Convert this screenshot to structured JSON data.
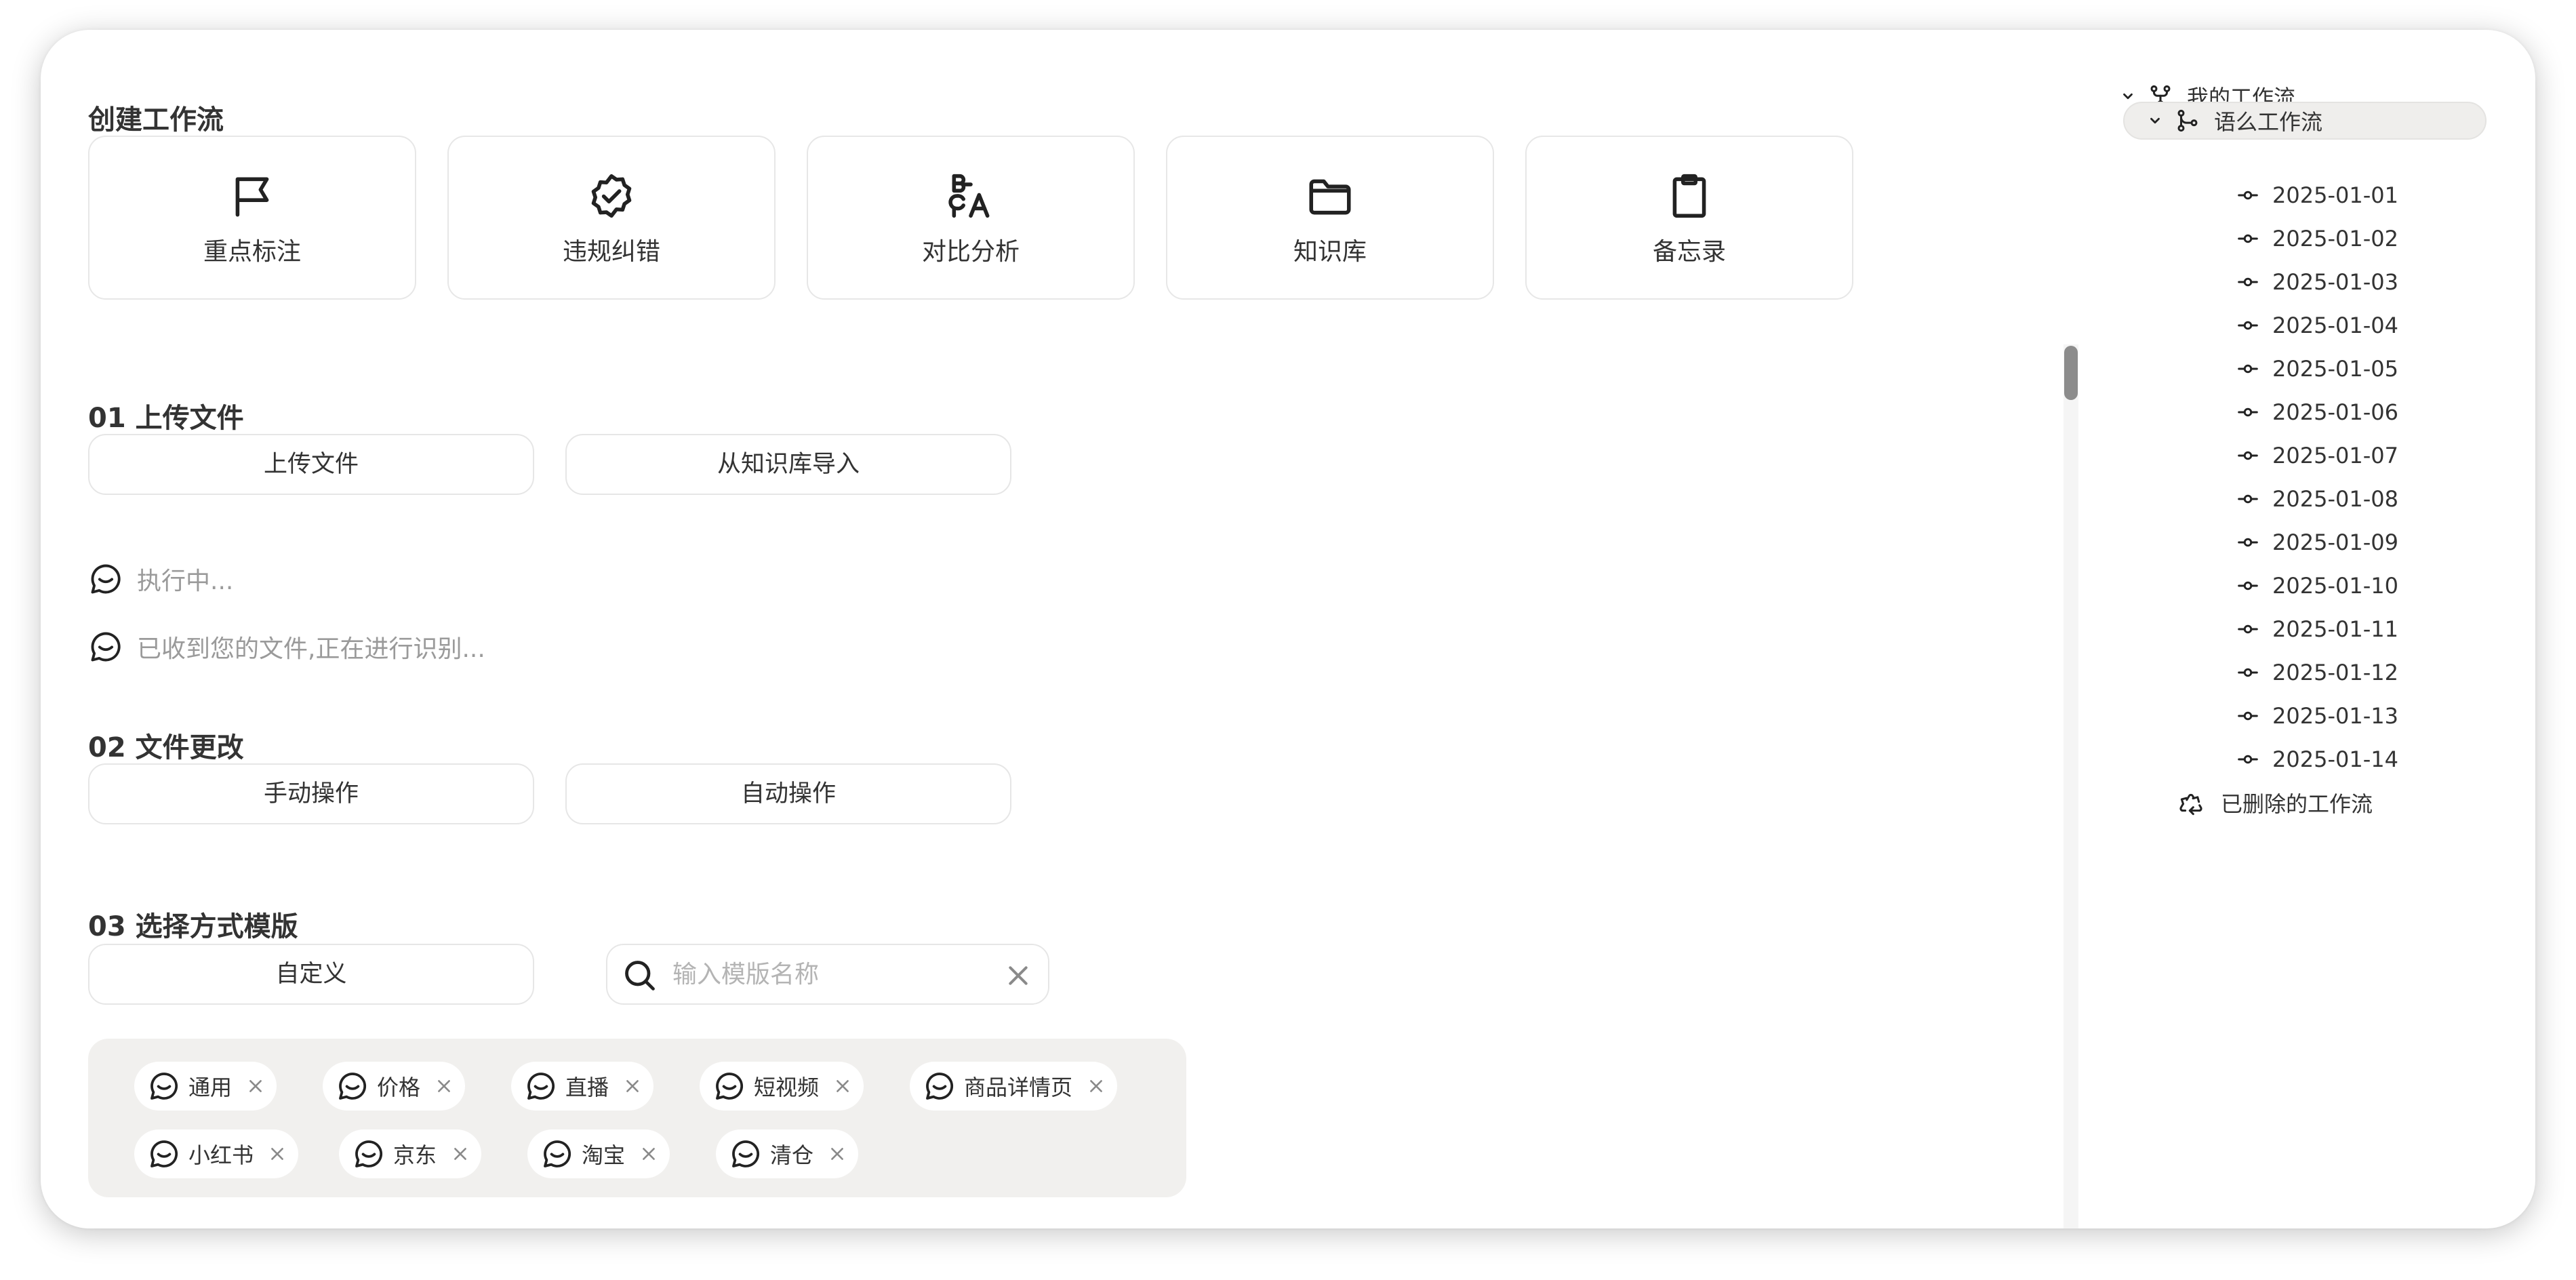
{
  "create": {
    "title": "创建工作流",
    "cards": [
      {
        "label": "重点标注",
        "icon": "flag-icon"
      },
      {
        "label": "违规纠错",
        "icon": "badge-check-icon"
      },
      {
        "label": "对比分析",
        "icon": "translate-compare-icon"
      },
      {
        "label": "知识库",
        "icon": "folder-icon"
      },
      {
        "label": "备忘录",
        "icon": "clipboard-icon"
      }
    ]
  },
  "upload": {
    "title": "01 上传文件",
    "upload_button": "上传文件",
    "import_button": "从知识库导入",
    "status": [
      {
        "text": "执行中...",
        "icon": "chat-bubble-icon"
      },
      {
        "text": "已收到您的文件,正在进行识别...",
        "icon": "chat-bubble-icon"
      }
    ]
  },
  "change": {
    "title": "02 文件更改",
    "manual_button": "手动操作",
    "auto_button": "自动操作"
  },
  "template": {
    "title": "03 选择方式模版",
    "custom_button": "自定义",
    "search_placeholder": "输入模版名称",
    "tags": [
      "通用",
      "价格",
      "直播",
      "短视频",
      "商品详情页",
      "小红书",
      "京东",
      "淘宝",
      "清仓"
    ]
  },
  "sidebar": {
    "root_label": "我的工作流",
    "root_icon": "git-fork-icon",
    "group_label": "语么工作流",
    "group_icon": "git-branch-icon",
    "entries": [
      "2025-01-01",
      "2025-01-02",
      "2025-01-03",
      "2025-01-04",
      "2025-01-05",
      "2025-01-06",
      "2025-01-07",
      "2025-01-08",
      "2025-01-09",
      "2025-01-10",
      "2025-01-11",
      "2025-01-12",
      "2025-01-13",
      "2025-01-14"
    ],
    "entry_icon": "git-commit-icon",
    "deleted_label": "已删除的工作流",
    "deleted_icon": "recycle-icon"
  },
  "colors": {
    "text": "#333333",
    "muted": "#9a9a9a",
    "card_border": "#e7e7e7",
    "tag_panel": "#f1f0ee",
    "selected_row": "#efeeec"
  }
}
